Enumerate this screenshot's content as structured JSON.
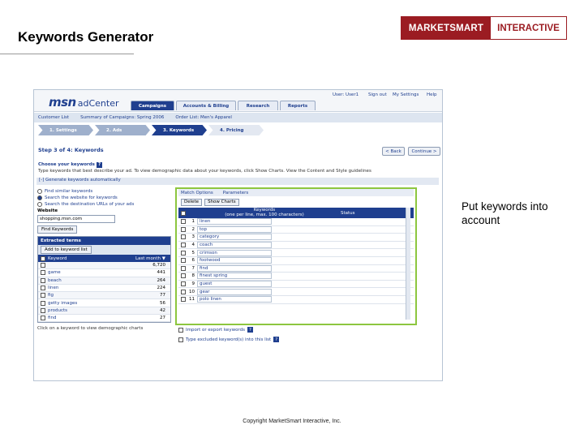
{
  "slide": {
    "title": "Keywords Generator",
    "logo_left": "MARKETSMART",
    "logo_right": "INTERACTIVE",
    "callout": "Put keywords into account",
    "copyright": "Copyright MarketSmart Interactive, Inc."
  },
  "app": {
    "brand_msn": "msn",
    "brand_ad": "adCenter",
    "tabs": [
      "Campaigns",
      "Accounts & Billing",
      "Research",
      "Reports"
    ],
    "top_links": [
      "User: User1",
      "Sign out",
      "My Settings",
      "Help"
    ],
    "breadcrumb": [
      "Customer List",
      "Summary of Campaigns: Spring 2006",
      "Order List: Men's Apparel"
    ],
    "steps": [
      "1. Settings",
      "2. Ads",
      "3. Keywords",
      "4. Pricing"
    ],
    "step_title": "Step 3 of 4:  Keywords",
    "back_label": "< Back",
    "continue_label": "Continue >",
    "choose_title": "Choose your keywords",
    "choose_desc": "Type keywords that best describe your ad. To view demographic data about your keywords, click Show Charts. View the Content and Style guidelines",
    "generate_row": "[-] Generate keywords automatically"
  },
  "left_panel": {
    "radios": [
      "Find similar keywords",
      "Search the website for keywords",
      "Search the destination URLs of your ads"
    ],
    "website_label": "Website",
    "website_value": "shopping.msn.com",
    "find_button": "Find Keywords",
    "extracted_title": "Extracted terms",
    "add_button": "Add to keyword list",
    "col_keyword": "Keyword",
    "col_last_month": "Last month",
    "rows": [
      {
        "kw": "",
        "n": "6,720"
      },
      {
        "kw": "game",
        "n": "441"
      },
      {
        "kw": "beach",
        "n": "264"
      },
      {
        "kw": "linen",
        "n": "224"
      },
      {
        "kw": "fig",
        "n": "77"
      },
      {
        "kw": "getty images",
        "n": "56"
      },
      {
        "kw": "products",
        "n": "42"
      },
      {
        "kw": "find",
        "n": "27"
      }
    ],
    "footer": "Click on a keyword to view demographic charts"
  },
  "right_panel": {
    "toolbar": [
      "Match Options",
      "Parameters"
    ],
    "delete_btn": "Delete",
    "charts_btn": "Show Charts",
    "col_keywords": "Keywords",
    "col_keywords_sub": "(one per line, max. 100 characters)",
    "col_status": "Status",
    "rows": [
      "linen",
      "top",
      "category",
      "coach",
      "crimson",
      "footwood",
      "find",
      "finest spring",
      "guest",
      "gear",
      "polo linen"
    ],
    "import_link": "Import or export keywords",
    "exclude_link": "Type excluded keyword(s) into this list"
  }
}
